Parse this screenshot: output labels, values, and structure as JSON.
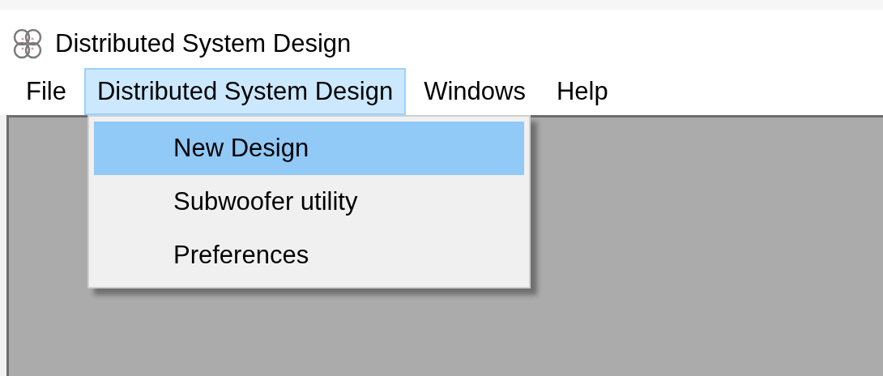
{
  "window": {
    "title": "Distributed System Design"
  },
  "menu_bar": [
    {
      "label": "File",
      "selected": false
    },
    {
      "label": "Distributed System Design",
      "selected": true
    },
    {
      "label": "Windows",
      "selected": false
    },
    {
      "label": "Help",
      "selected": false
    }
  ],
  "dropdown": [
    {
      "label": "New Design",
      "selected": true
    },
    {
      "label": "Subwoofer utility",
      "selected": false
    },
    {
      "label": "Preferences",
      "selected": false
    }
  ]
}
